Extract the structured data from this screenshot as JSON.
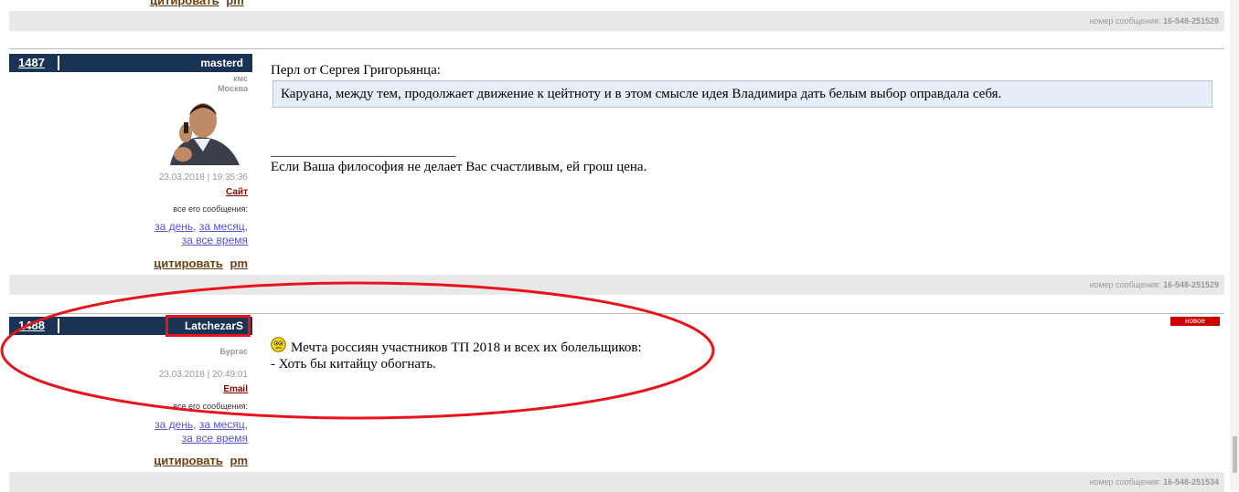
{
  "top": {
    "actions": {
      "quote": "цитировать",
      "pm": "pm"
    },
    "message_number": {
      "label": "номер сообщения:",
      "value": "16-548-251528"
    }
  },
  "posts": [
    {
      "number": "1487",
      "author": "masterd",
      "rank": "кмс",
      "city": "Москва",
      "date": "23.03.2018 | 19:35:36",
      "contact": "Сайт",
      "all_label": "все его сообщения:",
      "period_day": "за день",
      "period_month": "за месяц",
      "period_all": "за все время",
      "actions": {
        "quote": "цитировать",
        "pm": "pm"
      },
      "intro": "Перл от Сергея Григорьянца:",
      "quote_text": "Каруана, между тем, продолжает движение к цейтноту и в этом смысле идея Владимира дать белым выбор оправдала себя.",
      "signature_line": "___________________________",
      "signature": "Если Ваша философия не делает Вас счастливым, ей грош цена.",
      "message_number": {
        "label": "номер сообщения:",
        "value": "16-548-251529"
      }
    },
    {
      "number": "1488",
      "author": "LatchezarS",
      "city": "Бургас",
      "date": "23.03.2018 | 20:49:01",
      "contact": "Email",
      "all_label": "все его сообщения:",
      "period_day": "за день",
      "period_month": "за месяц",
      "period_all": "за все время",
      "actions": {
        "quote": "цитировать",
        "pm": "pm"
      },
      "badge": "новое",
      "line1": "Мечта россиян участников ТП 2018 и всех их болельщиков:",
      "line2": "- Хоть бы китайцу обогнать.",
      "message_number": {
        "label": "номер сообщения:",
        "value": "16-548-251534"
      }
    }
  ],
  "colors": {
    "header": "#1a3355",
    "annotation": "#e8141c",
    "quote_bg": "#e6eefa"
  },
  "icons": {
    "avatar": "user-photo",
    "smiley": "confused-smiley-icon"
  }
}
